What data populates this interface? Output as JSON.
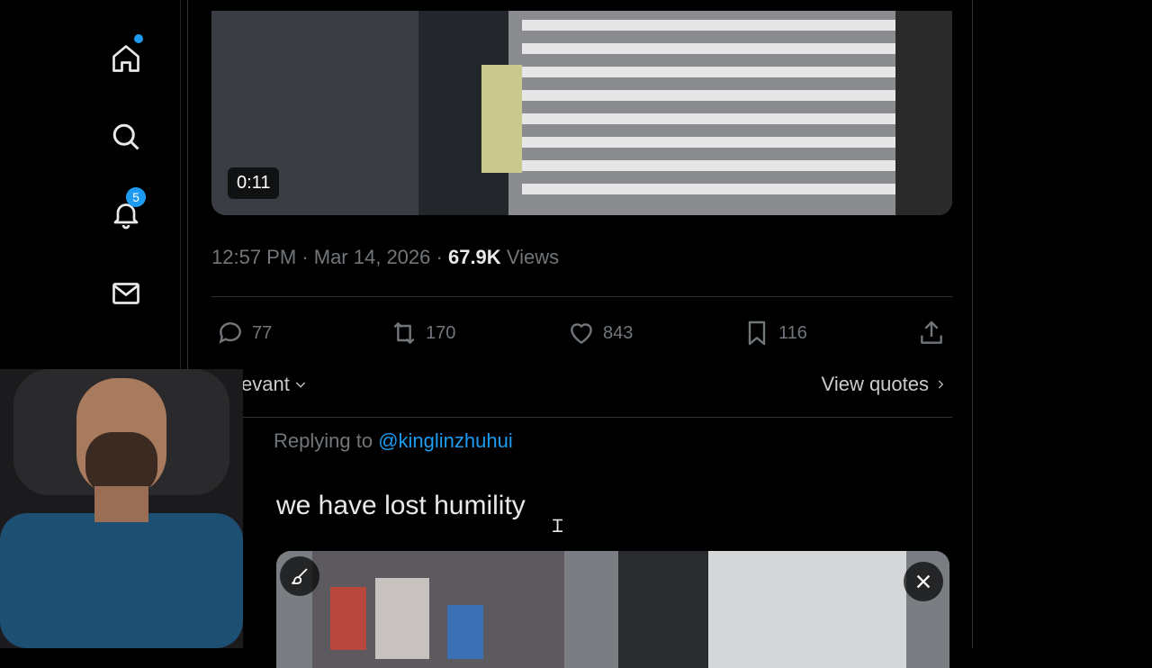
{
  "nav": {
    "items": [
      {
        "icon": "home-icon"
      },
      {
        "icon": "search-icon"
      },
      {
        "icon": "bell-icon",
        "badge": "5"
      },
      {
        "icon": "mail-icon"
      }
    ],
    "accent": "#1d9bf0"
  },
  "tweet": {
    "video_duration": "0:11",
    "time": "12:57 PM",
    "date": "Mar 14, 2026",
    "views_count": "67.9K",
    "views_label": "Views",
    "actions": {
      "replies": "77",
      "reposts": "170",
      "likes": "843",
      "bookmarks": "116"
    }
  },
  "thread": {
    "sort_label": "Relevant",
    "view_quotes_label": "View quotes",
    "reply": {
      "replying_to_label": "Replying to",
      "handle": "@kinglinzhuhui",
      "text": "we have lost humility"
    }
  }
}
